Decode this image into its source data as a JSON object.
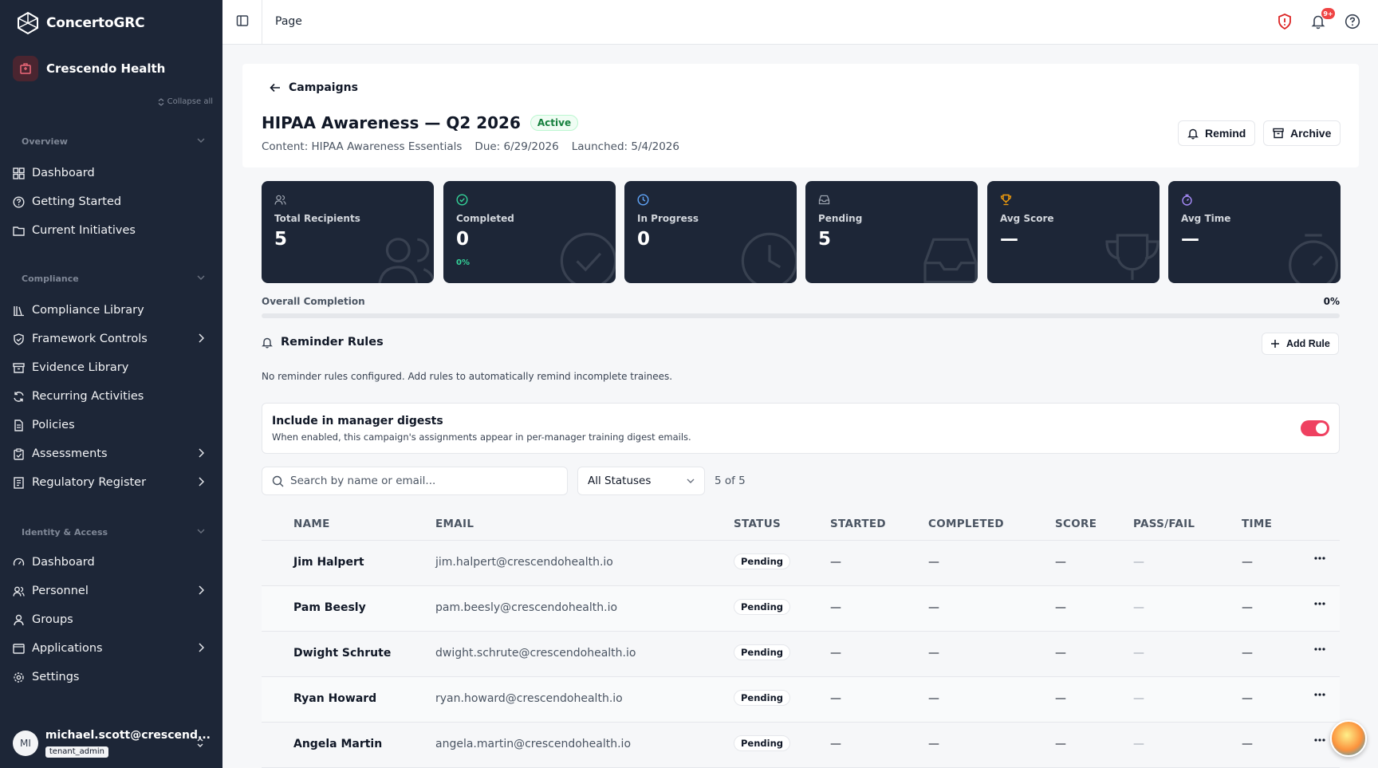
{
  "brand": {
    "name": "ConcertoGRC"
  },
  "org": {
    "name": "Crescendo Health"
  },
  "sidebar": {
    "collapse_all": "Collapse all",
    "sections": {
      "overview": "Overview",
      "compliance": "Compliance",
      "identity": "Identity & Access"
    },
    "overview_items": [
      {
        "label": "Dashboard",
        "icon": "dashboard-icon"
      },
      {
        "label": "Getting Started",
        "icon": "help-circle-icon"
      },
      {
        "label": "Current Initiatives",
        "icon": "folder-icon"
      }
    ],
    "compliance_items": [
      {
        "label": "Compliance Library",
        "icon": "library-icon",
        "chevron": false
      },
      {
        "label": "Framework Controls",
        "icon": "shield-check-icon",
        "chevron": true
      },
      {
        "label": "Evidence Library",
        "icon": "archive-icon",
        "chevron": false
      },
      {
        "label": "Recurring Activities",
        "icon": "refresh-icon",
        "chevron": false
      },
      {
        "label": "Policies",
        "icon": "file-text-icon",
        "chevron": false
      },
      {
        "label": "Assessments",
        "icon": "clipboard-check-icon",
        "chevron": true
      },
      {
        "label": "Regulatory Register",
        "icon": "register-icon",
        "chevron": true
      }
    ],
    "identity_items": [
      {
        "label": "Dashboard",
        "icon": "gauge-icon",
        "chevron": false
      },
      {
        "label": "Personnel",
        "icon": "users-icon",
        "chevron": true
      },
      {
        "label": "Groups",
        "icon": "user-group-icon",
        "chevron": false
      },
      {
        "label": "Applications",
        "icon": "app-window-icon",
        "chevron": true
      },
      {
        "label": "Settings",
        "icon": "gear-icon",
        "chevron": false
      }
    ],
    "user": {
      "initials": "MI",
      "email": "michael.scott@crescend...",
      "role": "tenant_admin"
    }
  },
  "topbar": {
    "breadcrumb": "Page",
    "notif_count": "9+"
  },
  "campaign": {
    "back_label": "Campaigns",
    "title": "HIPAA Awareness — Q2 2026",
    "status": "Active",
    "content": "Content: HIPAA Awareness Essentials",
    "due": "Due: 6/29/2026",
    "launched": "Launched: 5/4/2026",
    "remind_label": "Remind",
    "archive_label": "Archive"
  },
  "stats": [
    {
      "label": "Total Recipients",
      "value": "5",
      "sub": "",
      "icon": "users-icon",
      "color": "#9ca3af"
    },
    {
      "label": "Completed",
      "value": "0",
      "sub": "0%",
      "icon": "check-circle-icon",
      "color": "#34d399"
    },
    {
      "label": "In Progress",
      "value": "0",
      "sub": "",
      "icon": "clock-icon",
      "color": "#60a5fa"
    },
    {
      "label": "Pending",
      "value": "5",
      "sub": "",
      "icon": "inbox-icon",
      "color": "#9ca3af"
    },
    {
      "label": "Avg Score",
      "value": "—",
      "sub": "",
      "icon": "trophy-icon",
      "color": "#f59e0b"
    },
    {
      "label": "Avg Time",
      "value": "—",
      "sub": "",
      "icon": "timer-icon",
      "color": "#a78bfa"
    }
  ],
  "overall": {
    "label": "Overall Completion",
    "percent_text": "0%",
    "fraction": 0
  },
  "reminders": {
    "title": "Reminder Rules",
    "add_label": "Add Rule",
    "empty_text": "No reminder rules configured. Add rules to automatically remind incomplete trainees."
  },
  "digest": {
    "title": "Include in manager digests",
    "subtitle": "When enabled, this campaign's assignments appear in per-manager training digest emails.",
    "enabled": true
  },
  "filters": {
    "search_placeholder": "Search by name or email...",
    "status_value": "All Statuses",
    "count_text": "5 of 5"
  },
  "table": {
    "columns": [
      "NAME",
      "EMAIL",
      "STATUS",
      "STARTED",
      "COMPLETED",
      "SCORE",
      "PASS/FAIL",
      "TIME"
    ],
    "rows": [
      {
        "name": "Jim Halpert",
        "email": "jim.halpert@crescendohealth.io",
        "status": "Pending",
        "started": "—",
        "completed": "—",
        "score": "—",
        "passfail": "—",
        "time": "—"
      },
      {
        "name": "Pam Beesly",
        "email": "pam.beesly@crescendohealth.io",
        "status": "Pending",
        "started": "—",
        "completed": "—",
        "score": "—",
        "passfail": "—",
        "time": "—"
      },
      {
        "name": "Dwight Schrute",
        "email": "dwight.schrute@crescendohealth.io",
        "status": "Pending",
        "started": "—",
        "completed": "—",
        "score": "—",
        "passfail": "—",
        "time": "—"
      },
      {
        "name": "Ryan Howard",
        "email": "ryan.howard@crescendohealth.io",
        "status": "Pending",
        "started": "—",
        "completed": "—",
        "score": "—",
        "passfail": "—",
        "time": "—"
      },
      {
        "name": "Angela Martin",
        "email": "angela.martin@crescendohealth.io",
        "status": "Pending",
        "started": "—",
        "completed": "—",
        "score": "—",
        "passfail": "—",
        "time": "—"
      }
    ]
  }
}
